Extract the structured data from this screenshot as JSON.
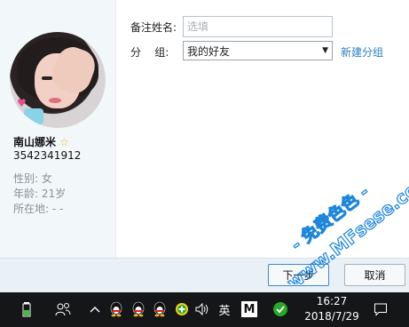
{
  "profile": {
    "nickname": "南山娜米",
    "qq_number": "3542341912",
    "gender": "性别: 女",
    "age": "年龄: 21岁",
    "location": "所在地: -    -"
  },
  "form": {
    "remark_label": "备注姓名:",
    "remark_placeholder": "选填",
    "remark_value": "",
    "group_label": "分    组:",
    "group_value": "我的好友",
    "new_group_label": "新建分组"
  },
  "buttons": {
    "next_label": "下一步",
    "cancel_label": "取消"
  },
  "watermark": {
    "line1": "- 免费色色 -",
    "line2": "www.MFsese.com"
  },
  "taskbar": {
    "ime_label": "英",
    "m_label": "M",
    "time": "16:27",
    "date": "2018/7/29"
  },
  "colors": {
    "link": "#2b7fc0",
    "accent_star": "#f3b617",
    "watermark": "#1f86d9",
    "taskbar_bg": "#141617"
  },
  "icons": [
    "battery-icon",
    "people-icon",
    "chevron-up-icon",
    "qq-penguin-icon",
    "green-plus-icon",
    "speaker-icon",
    "wechat-icon",
    "notification-icon",
    "star-icon"
  ]
}
